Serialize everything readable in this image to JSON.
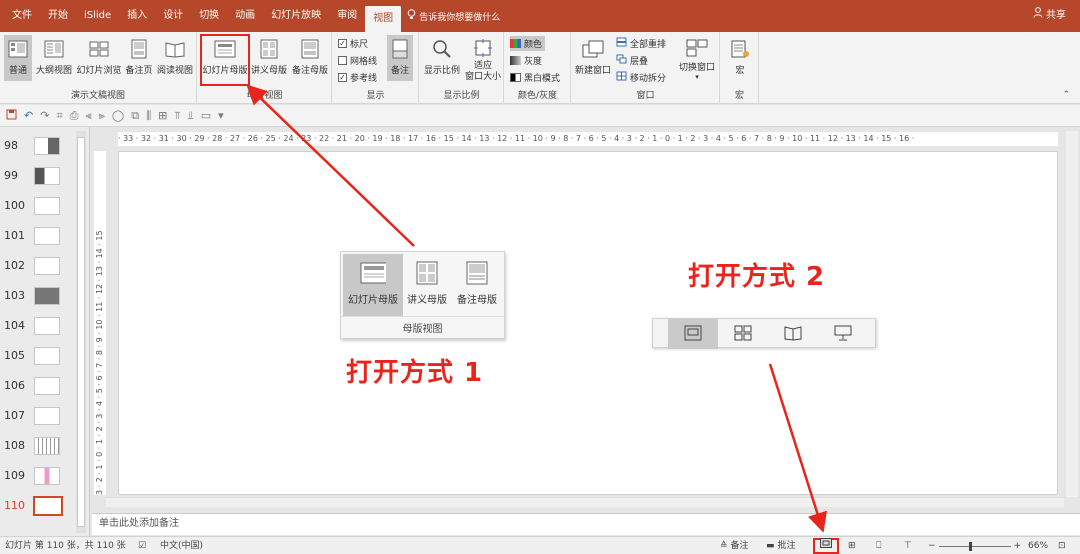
{
  "tabs": [
    "文件",
    "开始",
    "iSlide",
    "插入",
    "设计",
    "切换",
    "动画",
    "幻灯片放映",
    "审阅",
    "视图"
  ],
  "active_tab": "视图",
  "tell_me": "告诉我你想要做什么",
  "share": "共享",
  "ribbon": {
    "presentation_views": {
      "label": "演示文稿视图",
      "buttons": [
        "普通",
        "大纲视图",
        "幻灯片浏览",
        "备注页",
        "阅读视图"
      ]
    },
    "master_views": {
      "label": "母版视图",
      "buttons": [
        "幻灯片母版",
        "讲义母版",
        "备注母版"
      ]
    },
    "show": {
      "label": "显示",
      "checks": [
        {
          "label": "标尺",
          "checked": true
        },
        {
          "label": "网格线",
          "checked": false
        },
        {
          "label": "参考线",
          "checked": true
        }
      ],
      "notes_label": "备注"
    },
    "zoom": {
      "label": "显示比例",
      "buttons": [
        "显示比例",
        "适应\n窗口大小"
      ]
    },
    "color": {
      "label": "颜色/灰度",
      "items": [
        "颜色",
        "灰度",
        "黑白模式"
      ]
    },
    "window": {
      "label": "窗口",
      "new_window": "新建窗口",
      "items": [
        "全部重排",
        "层叠",
        "移动拆分"
      ],
      "switch": "切换窗口"
    },
    "macros": {
      "label": "宏",
      "button": "宏"
    }
  },
  "slides": [
    "98",
    "99",
    "100",
    "101",
    "102",
    "103",
    "104",
    "105",
    "106",
    "107",
    "108",
    "109",
    "110"
  ],
  "current_slide": "110",
  "ruler_h": "· 33 · 32 · 31 · 30 · 29 · 28 · 27 · 26 · 25 · 24 · 23 · 22 · 21 · 20 · 19 · 18 · 17 · 16 · 15 · 14 · 13 · 12 · 11 · 10 · 9 · 8 · 7 · 6 · 5 · 4 · 3 · 2 · 1 · 0 · 1 · 2 · 3 · 4 · 5 · 6 · 7 · 8 · 9 · 10 · 11 · 12 · 13 · 14 · 15 · 16 ·",
  "ruler_v": "3 · 2 · 1 · 0 · 1 · 2 · 3 · 4 · 5 · 6 · 7 · 8 · 9 · 10 · 11 · 12 · 13 · 14 · 15",
  "master_panel": {
    "buttons": [
      "幻灯片母版",
      "讲义母版",
      "备注母版"
    ],
    "label": "母版视图"
  },
  "callout1": "打开方式 1",
  "callout2": "打开方式 2",
  "notes_placeholder": "单击此处添加备注",
  "status": {
    "slide_info": "幻灯片 第 110 张，共 110 张",
    "language": "中文(中国)",
    "notes": "备注",
    "comments": "批注",
    "zoom": "66%"
  },
  "colors": {
    "accent": "#b7472a",
    "highlight": "#e8241c"
  }
}
